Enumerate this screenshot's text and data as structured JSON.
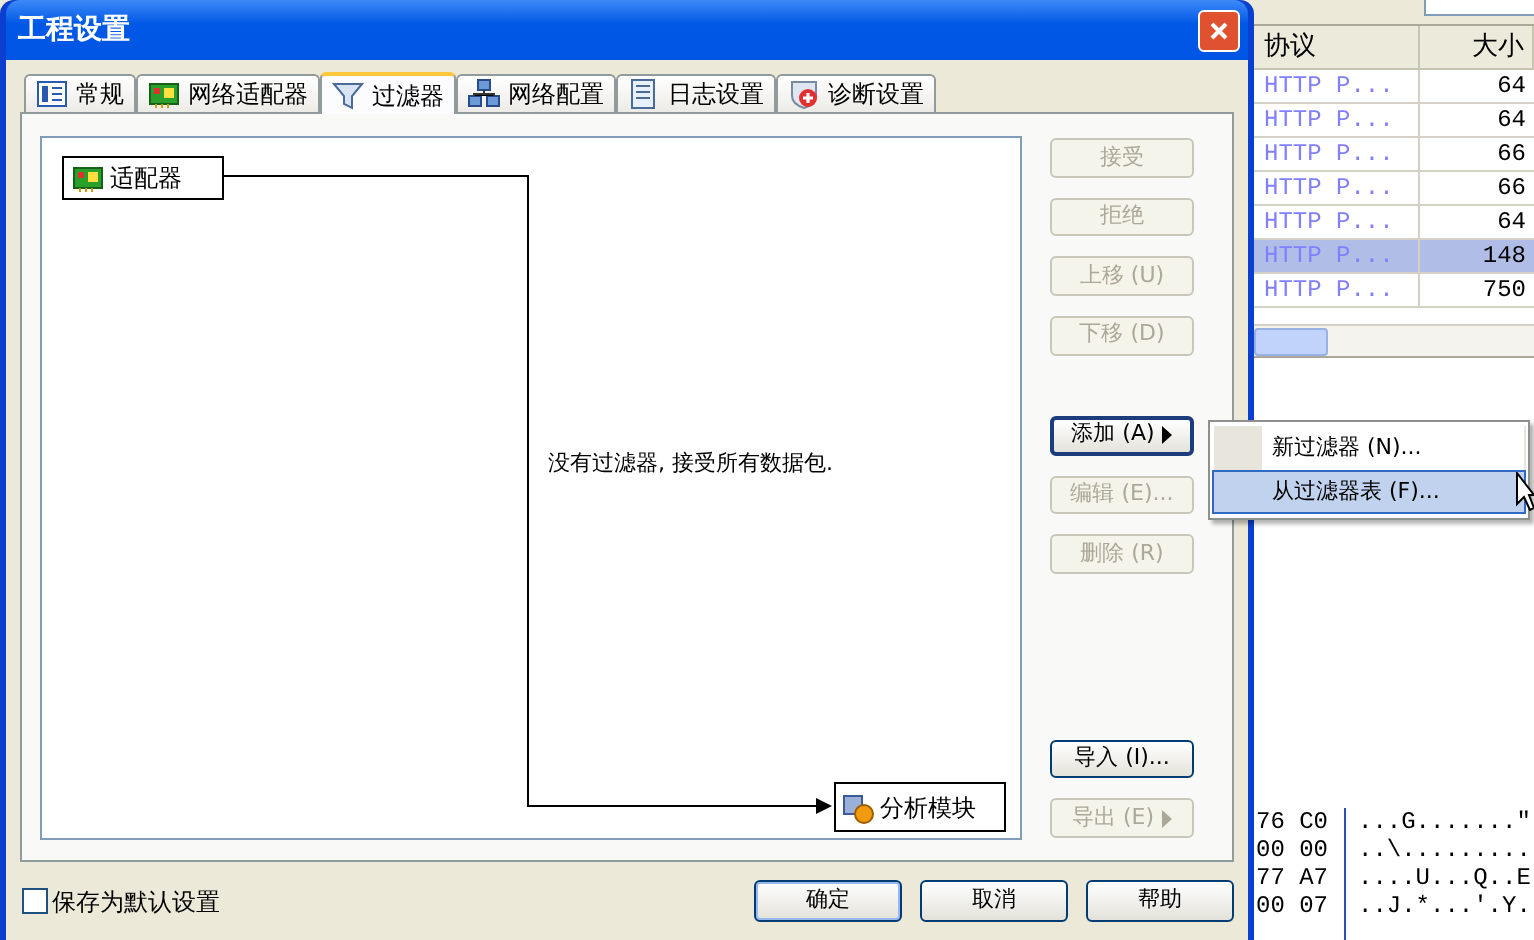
{
  "background_app": {
    "table": {
      "columns": [
        "协议",
        "大小"
      ],
      "rows": [
        {
          "protocol": "HTTP P...",
          "size": "64",
          "selected": false
        },
        {
          "protocol": "HTTP P...",
          "size": "64",
          "selected": false
        },
        {
          "protocol": "HTTP P...",
          "size": "66",
          "selected": false
        },
        {
          "protocol": "HTTP P...",
          "size": "66",
          "selected": false
        },
        {
          "protocol": "HTTP P...",
          "size": "64",
          "selected": false
        },
        {
          "protocol": "HTTP P...",
          "size": "148",
          "selected": true
        },
        {
          "protocol": "HTTP P...",
          "size": "750",
          "selected": false
        }
      ]
    },
    "hex_dump": [
      {
        "hex": "76 C0",
        "ascii": "...G.......\""
      },
      {
        "hex": "00 00",
        "ascii": "..\\........."
      },
      {
        "hex": "77 A7",
        "ascii": "....U...Q..E"
      },
      {
        "hex": "00 07",
        "ascii": "..J.*...'.Y."
      }
    ]
  },
  "window": {
    "title": "工程设置"
  },
  "tabs": [
    {
      "label": "常规",
      "selected": false
    },
    {
      "label": "网络适配器",
      "selected": false
    },
    {
      "label": "过滤器",
      "selected": true
    },
    {
      "label": "网络配置",
      "selected": false
    },
    {
      "label": "日志设置",
      "selected": false
    },
    {
      "label": "诊断设置",
      "selected": false
    }
  ],
  "canvas": {
    "source_node": "适配器",
    "target_node": "分析模块",
    "message": "没有过滤器, 接受所有数据包."
  },
  "side_buttons": [
    {
      "label": "接受",
      "disabled": true,
      "submenu": false,
      "focused": false
    },
    {
      "label": "拒绝",
      "disabled": true,
      "submenu": false,
      "focused": false
    },
    {
      "label": "上移 (U)",
      "disabled": true,
      "submenu": false,
      "focused": false
    },
    {
      "label": "下移 (D)",
      "disabled": true,
      "submenu": false,
      "focused": false
    },
    {
      "label": "添加 (A)",
      "disabled": false,
      "submenu": true,
      "focused": true
    },
    {
      "label": "编辑 (E)...",
      "disabled": true,
      "submenu": false,
      "focused": false
    },
    {
      "label": "删除 (R)",
      "disabled": true,
      "submenu": false,
      "focused": false
    },
    {
      "label": "导入 (I)...",
      "disabled": false,
      "submenu": false,
      "focused": false
    },
    {
      "label": "导出 (E)",
      "disabled": true,
      "submenu": true,
      "focused": false
    }
  ],
  "context_menu": [
    {
      "label": "新过滤器 (N)...",
      "selected": false
    },
    {
      "label": "从过滤器表 (F)...",
      "selected": true
    }
  ],
  "save_default": {
    "label": "保存为默认设置",
    "checked": false
  },
  "dialog_buttons": [
    {
      "label": "确定",
      "default": true
    },
    {
      "label": "取消",
      "default": false
    },
    {
      "label": "帮助",
      "default": false
    }
  ]
}
